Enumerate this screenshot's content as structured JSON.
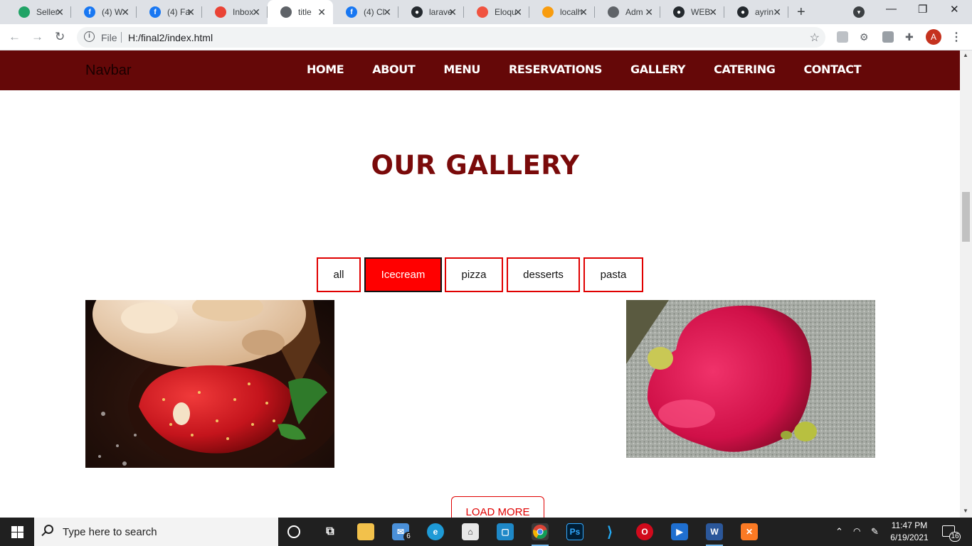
{
  "browser": {
    "tabs": [
      {
        "title": "Seller",
        "favicon": "green-circle",
        "color": "#21a366",
        "active": false
      },
      {
        "title": "(4) W",
        "favicon": "facebook",
        "color": "#1877f2",
        "active": false
      },
      {
        "title": "(4) Fa",
        "favicon": "facebook",
        "color": "#1877f2",
        "active": false
      },
      {
        "title": "Inbox",
        "favicon": "gmail",
        "color": "#ea4335",
        "active": false
      },
      {
        "title": "title",
        "favicon": "globe",
        "color": "#5f6368",
        "active": true
      },
      {
        "title": "(4) Cl",
        "favicon": "facebook",
        "color": "#1877f2",
        "active": false
      },
      {
        "title": "larave",
        "favicon": "github",
        "color": "#24292e",
        "active": false
      },
      {
        "title": "Eloqu",
        "favicon": "laravel",
        "color": "#f05340",
        "active": false
      },
      {
        "title": "localh",
        "favicon": "phpmyadmin",
        "color": "#f89c0e",
        "active": false
      },
      {
        "title": "Adm",
        "favicon": "globe",
        "color": "#5f6368",
        "active": false
      },
      {
        "title": "WEB",
        "favicon": "github",
        "color": "#24292e",
        "active": false
      },
      {
        "title": "ayrin",
        "favicon": "github",
        "color": "#24292e",
        "active": false
      }
    ],
    "new_tab": "+",
    "address": {
      "scheme_label": "File",
      "url": "H:/final2/index.html"
    },
    "profile_initial": "A"
  },
  "site": {
    "brand": "Navbar",
    "nav": [
      "HOME",
      "ABOUT",
      "MENU",
      "RESERVATIONS",
      "GALLERY",
      "CATERING",
      "CONTACT"
    ],
    "gallery_title": "OUR GALLERY",
    "filters": [
      {
        "label": "all",
        "active": false
      },
      {
        "label": "Icecream",
        "active": true
      },
      {
        "label": "pizza",
        "active": false
      },
      {
        "label": "desserts",
        "active": false
      },
      {
        "label": "pasta",
        "active": false
      }
    ],
    "images": [
      {
        "name": "icecream-strawberry-image",
        "subject": "ice cream scoop with strawberry"
      },
      {
        "name": "red-dessert-image",
        "subject": "blurred red dessert"
      }
    ],
    "load_more": "LOAD MORE",
    "colors": {
      "navbar": "#650808",
      "title": "#7a0a0a",
      "accent": "#ff0000"
    }
  },
  "taskbar": {
    "search_placeholder": "Type here to search",
    "apps": [
      "cortana-icon",
      "task-view-icon",
      "file-explorer-icon",
      "mail-icon",
      "edge-icon",
      "store-icon",
      "app-icon",
      "chrome-icon",
      "photoshop-icon",
      "vscode-icon",
      "opera-icon",
      "media-player-icon",
      "word-icon",
      "xampp-icon"
    ],
    "mail_badge": "6",
    "time": "11:47 PM",
    "date": "6/19/2021",
    "notifications": "16"
  }
}
